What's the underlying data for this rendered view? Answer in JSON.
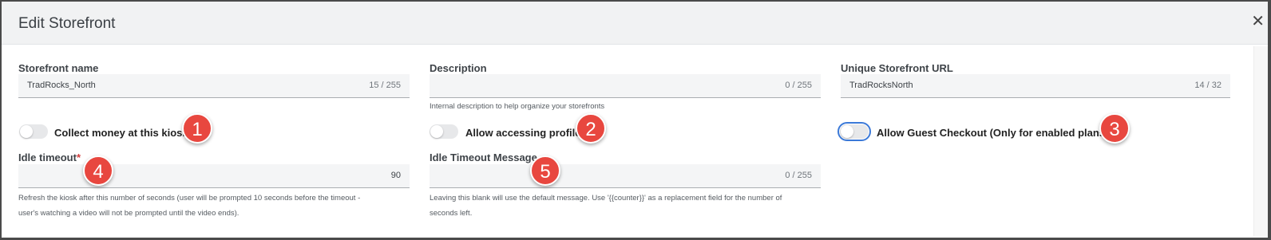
{
  "dialog": {
    "title": "Edit Storefront"
  },
  "storefront_name": {
    "label": "Storefront name",
    "value": "TradRocks_North",
    "count": "15 / 255"
  },
  "description": {
    "label": "Description",
    "value": "",
    "count": "0 / 255",
    "hint": "Internal description to help organize your storefronts"
  },
  "unique_url": {
    "label": "Unique Storefront URL",
    "value": "TradRocksNorth",
    "count": "14 / 32"
  },
  "toggles": {
    "collect_money": "Collect money at this kiosk",
    "allow_profile": "Allow accessing profile",
    "guest_checkout": "Allow Guest Checkout (Only for enabled plans)"
  },
  "idle_timeout": {
    "label": "Idle timeout",
    "required_mark": "*",
    "value": "90",
    "hint_line1": "Refresh the kiosk after this number of seconds (user will be prompted 10 seconds before the timeout -",
    "hint_line2": "user's watching a video will not be prompted until the video ends)."
  },
  "idle_message": {
    "label": "Idle Timeout Message",
    "count": "0 / 255",
    "hint_line1": "Leaving this blank will use the default message. Use '{{counter}}' as a replacement field for the number of",
    "hint_line2": "seconds left."
  },
  "badges": [
    "1",
    "2",
    "3",
    "4",
    "5"
  ],
  "colors": {
    "badge": "#e8473f",
    "focus_ring": "#3b79d8",
    "field_bg": "#f4f5f6"
  }
}
